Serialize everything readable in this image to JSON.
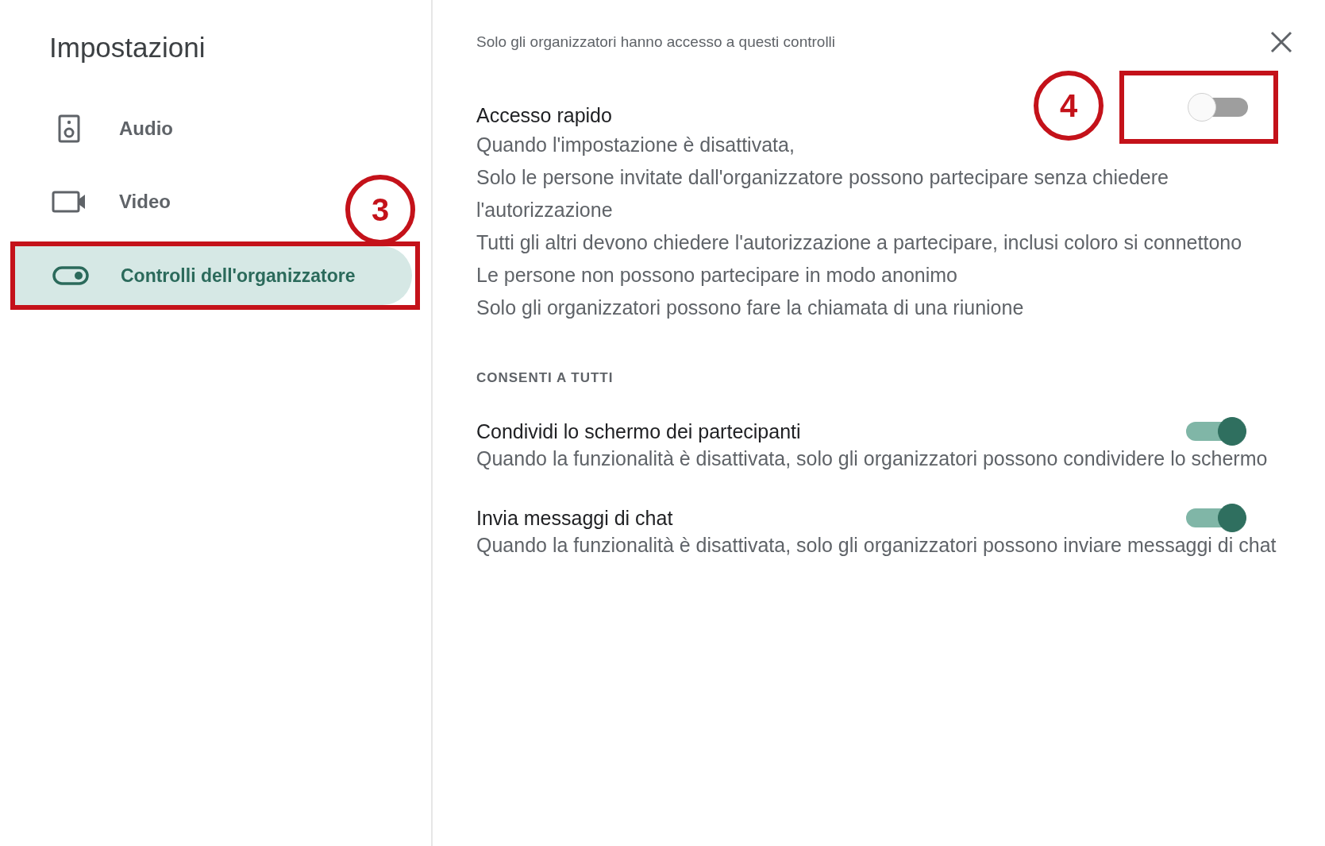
{
  "sidebar": {
    "title": "Impostazioni",
    "items": [
      {
        "label": "Audio",
        "selected": false
      },
      {
        "label": "Video",
        "selected": false
      },
      {
        "label": "Controlli dell'organizzatore",
        "selected": true,
        "callout": "3"
      }
    ]
  },
  "panel": {
    "notice": "Solo gli organizzatori hanno accesso a questi controlli",
    "settings": [
      {
        "title": "Accesso rapido",
        "on": false,
        "callout": "4",
        "lines": [
          "Quando l'impostazione è disattivata,",
          "Solo le persone invitate dall'organizzatore possono partecipare senza chiedere l'autorizzazione",
          "Tutti gli altri devono chiedere l'autorizzazione a partecipare, inclusi coloro si connettono",
          "Le persone non possono partecipare in modo anonimo",
          "Solo gli organizzatori possono fare la chiamata di una riunione"
        ]
      }
    ],
    "section": "CONSENTI A TUTTI",
    "section_settings": [
      {
        "title": "Condividi lo schermo dei partecipanti",
        "on": true,
        "lines": [
          "Quando la funzionalità è disattivata, solo gli organizzatori possono condividere lo schermo"
        ]
      },
      {
        "title": "Invia messaggi di chat",
        "on": true,
        "lines": [
          "Quando la funzionalità è disattivata, solo gli organizzatori possono inviare messaggi di chat"
        ]
      }
    ]
  }
}
